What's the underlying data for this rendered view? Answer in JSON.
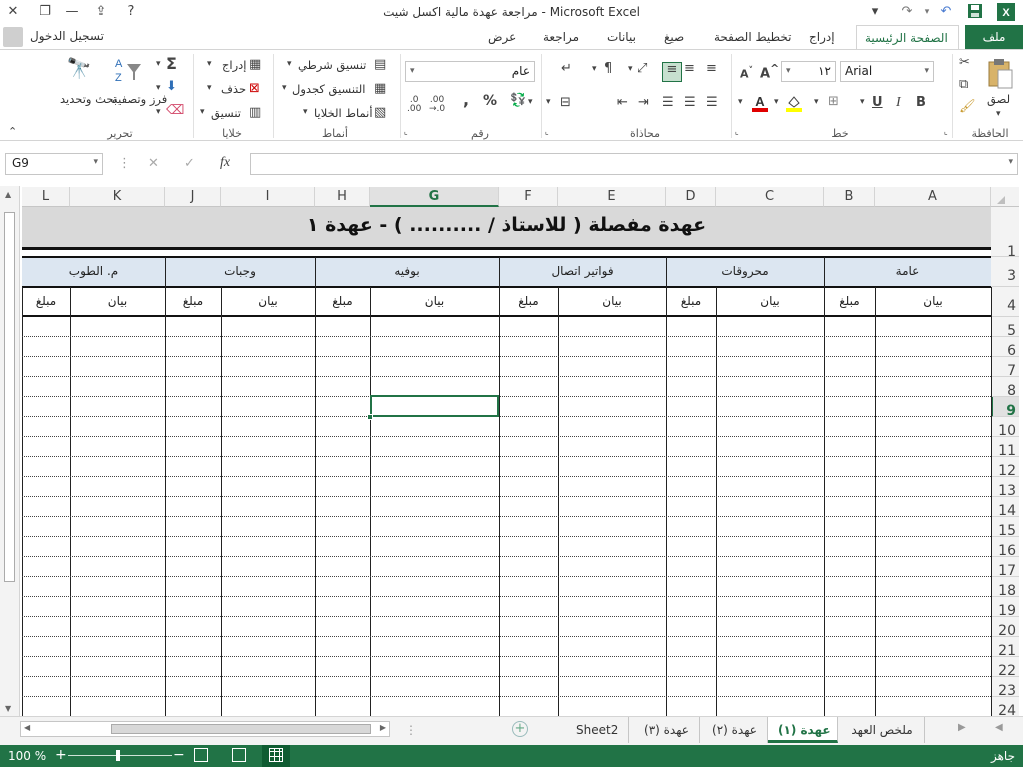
{
  "window": {
    "title": "مراجعة عهدة مالية اكسل شيت - Microsoft Excel"
  },
  "tabs": [
    {
      "label": "ملف"
    },
    {
      "label": "الصفحة الرئيسية"
    },
    {
      "label": "إدراج"
    },
    {
      "label": "تخطيط الصفحة"
    },
    {
      "label": "صيغ"
    },
    {
      "label": "بيانات"
    },
    {
      "label": "مراجعة"
    },
    {
      "label": "عرض"
    }
  ],
  "signin": "تسجيل الدخول",
  "ribbon": {
    "groups": {
      "clipboard": "الحافظة",
      "font": "خط",
      "alignment": "محاذاة",
      "number": "رقم",
      "styles": "أنماط",
      "cells": "خلايا",
      "editing": "تحرير"
    },
    "paste": "لصق",
    "font_name": "Arial",
    "font_size": "١٢",
    "number_format": "عام",
    "conditional_formatting": "تنسيق شرطي",
    "format_as_table": "التنسيق كجدول",
    "cell_styles": "أنماط الخلايا",
    "insert": "إدراج",
    "delete": "حذف",
    "format": "تنسيق",
    "sort_filter": "فرز وتصفية",
    "find_select": "بحث وتحديد"
  },
  "formula_bar": {
    "name_box": "G9",
    "fx": "fx",
    "value": ""
  },
  "sheet": {
    "columns": [
      "A",
      "B",
      "C",
      "D",
      "E",
      "F",
      "G",
      "H",
      "I",
      "J",
      "K",
      "L"
    ],
    "selected_column": "G",
    "title": "عهدة مفصلة ( للاستاذ / .......... ) - عهدة ١",
    "groups": [
      "عامة",
      "محروقات",
      "فواتير اتصال",
      "بوفيه",
      "وجبات",
      "م. الطوب"
    ],
    "sub_headers": {
      "statement": "بيان",
      "amount": "مبلغ"
    },
    "row_numbers": [
      "1",
      "3",
      "4",
      "5",
      "6",
      "7",
      "8",
      "9",
      "10",
      "11",
      "12",
      "13",
      "14",
      "15",
      "16",
      "17",
      "18",
      "19",
      "20",
      "21",
      "22",
      "23",
      "24"
    ],
    "selected_row": "9"
  },
  "sheet_tabs": [
    {
      "label": "ملخص العهد",
      "active": false
    },
    {
      "label": "عهدة (١)",
      "active": true
    },
    {
      "label": "عهدة (٢)",
      "active": false
    },
    {
      "label": "عهدة (٣)",
      "active": false
    },
    {
      "label": "Sheet2",
      "active": false
    }
  ],
  "status": {
    "ready": "جاهز",
    "zoom": "100 %"
  }
}
